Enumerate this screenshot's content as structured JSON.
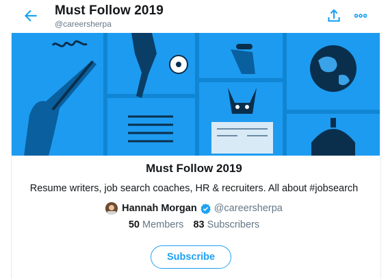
{
  "header": {
    "title": "Must Follow 2019",
    "handle": "@careersherpa",
    "back_icon": "arrow-left-icon",
    "share_icon": "share-icon",
    "more_icon": "more-horizontal-icon"
  },
  "banner": {
    "panels": [
      "hand-writing-icon",
      "soccer-player-icon",
      "microphone-icon",
      "globe-icon",
      "lines-icon",
      "dog-reading-newspaper-icon",
      "capitol-dome-icon"
    ]
  },
  "list": {
    "name": "Must Follow 2019",
    "description": "Resume writers, job search coaches, HR & recruiters. All about #jobsearch",
    "owner_name": "Hannah Morgan",
    "owner_handle": "@careersherpa",
    "verified_icon": "verified-badge-icon",
    "members_count": "50",
    "members_label": "Members",
    "subscribers_count": "83",
    "subscribers_label": "Subscribers",
    "subscribe_label": "Subscribe"
  },
  "colors": {
    "accent": "#1da1f2",
    "banner_blue": "#1d9bf0",
    "banner_dark": "#0a5f9e",
    "muted_text": "#657786"
  }
}
